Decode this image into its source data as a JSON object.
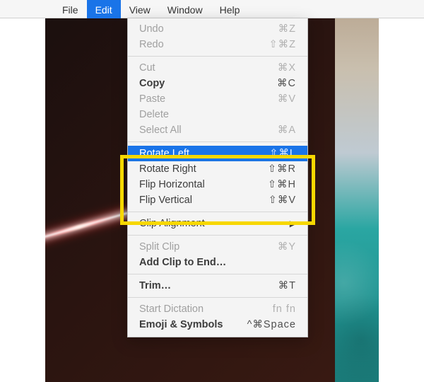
{
  "menubar": {
    "items": [
      {
        "label": "File",
        "active": false
      },
      {
        "label": "Edit",
        "active": true
      },
      {
        "label": "View",
        "active": false
      },
      {
        "label": "Window",
        "active": false
      },
      {
        "label": "Help",
        "active": false
      }
    ]
  },
  "dropdown": {
    "groups": [
      [
        {
          "label": "Undo",
          "shortcut": "⌘Z",
          "disabled": true
        },
        {
          "label": "Redo",
          "shortcut": "⇧⌘Z",
          "disabled": true
        }
      ],
      [
        {
          "label": "Cut",
          "shortcut": "⌘X",
          "disabled": true
        },
        {
          "label": "Copy",
          "shortcut": "⌘C",
          "bold": true
        },
        {
          "label": "Paste",
          "shortcut": "⌘V",
          "disabled": true
        },
        {
          "label": "Delete",
          "disabled": true
        },
        {
          "label": "Select All",
          "shortcut": "⌘A",
          "disabled": true
        }
      ],
      [
        {
          "label": "Rotate Left",
          "shortcut": "⇧⌘L",
          "selected": true
        },
        {
          "label": "Rotate Right",
          "shortcut": "⇧⌘R"
        },
        {
          "label": "Flip Horizontal",
          "shortcut": "⇧⌘H"
        },
        {
          "label": "Flip Vertical",
          "shortcut": "⇧⌘V"
        }
      ],
      [
        {
          "label": "Clip Alignment",
          "submenu": true
        }
      ],
      [
        {
          "label": "Split Clip",
          "shortcut": "⌘Y",
          "disabled": true
        },
        {
          "label": "Add Clip to End…",
          "bold": true
        }
      ],
      [
        {
          "label": "Trim…",
          "shortcut": "⌘T",
          "bold": true
        }
      ],
      [
        {
          "label": "Start Dictation",
          "shortcut": "fn fn",
          "disabled": true
        },
        {
          "label": "Emoji & Symbols",
          "shortcut": "^⌘Space",
          "bold": true
        }
      ]
    ]
  },
  "highlight": {
    "purpose": "rotate-flip-group"
  }
}
